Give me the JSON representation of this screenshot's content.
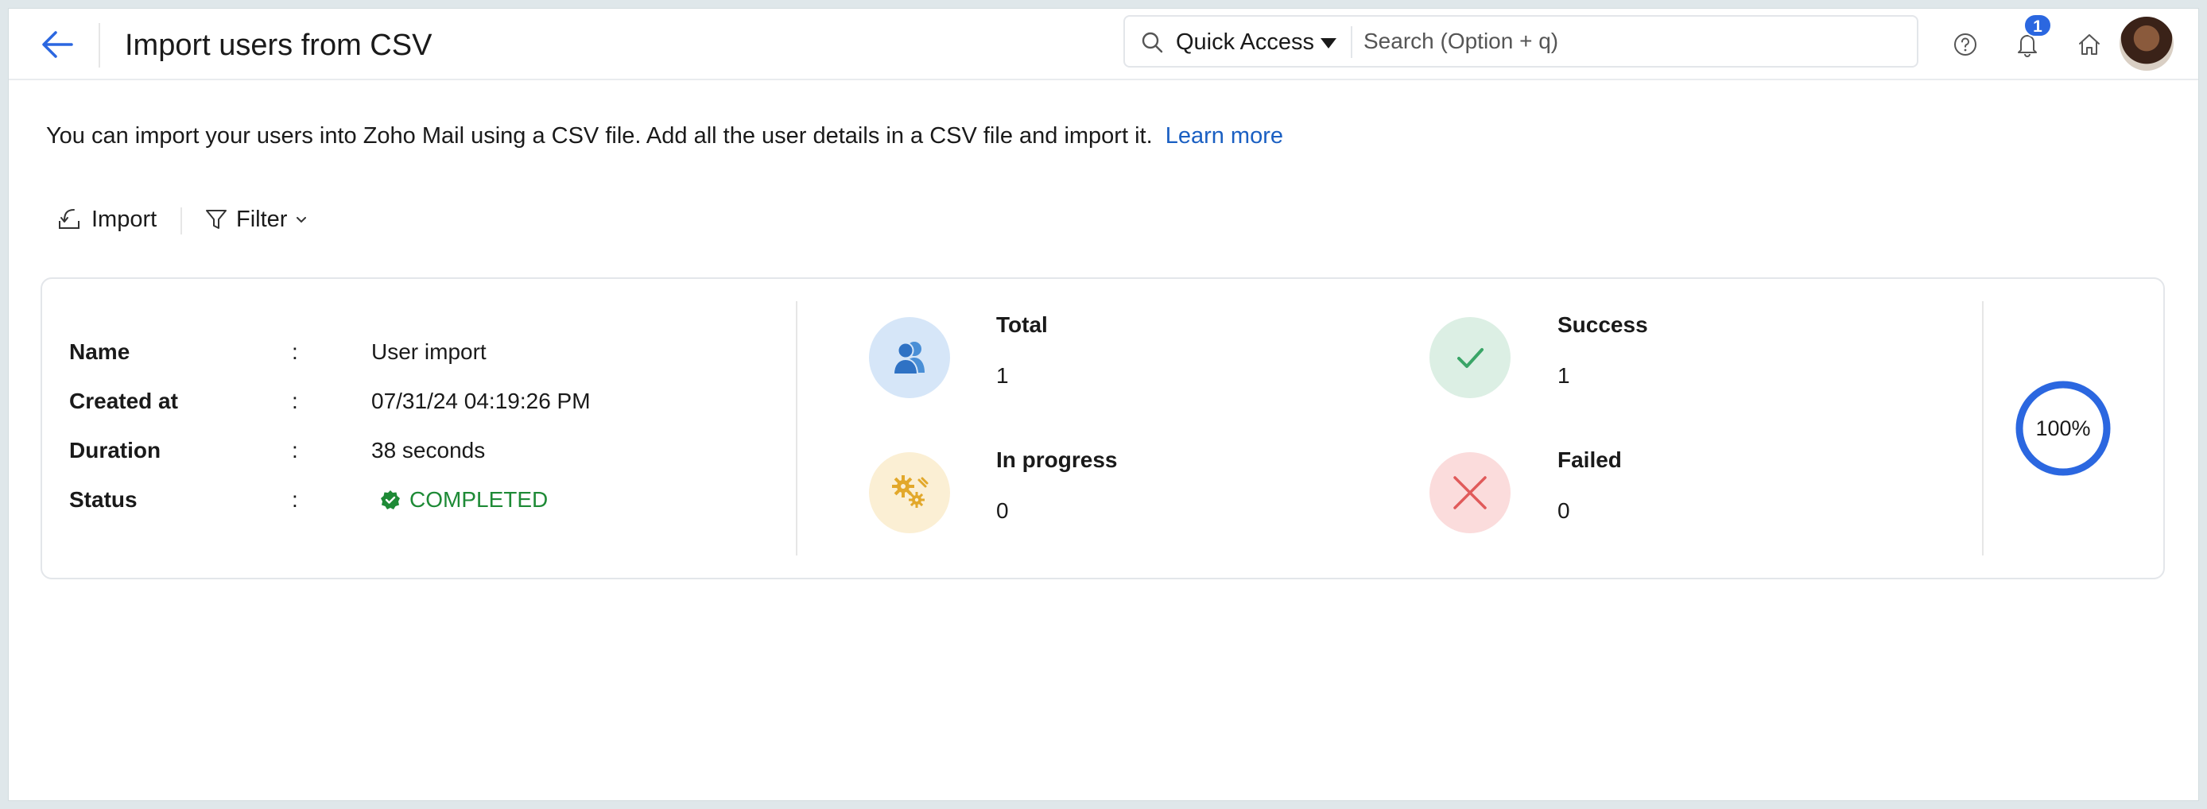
{
  "header": {
    "title": "Import users from CSV",
    "quick_access_label": "Quick Access",
    "search_placeholder": "Search (Option + q)",
    "notification_count": "1"
  },
  "intro": {
    "text": "You can import your users into Zoho Mail using a CSV file. Add all the user details in a CSV file and import it.",
    "link": "Learn more"
  },
  "toolbar": {
    "import_label": "Import",
    "filter_label": "Filter"
  },
  "import_job": {
    "rows": [
      {
        "key": "Name",
        "value": "User import"
      },
      {
        "key": "Created at",
        "value": "07/31/24 04:19:26 PM"
      },
      {
        "key": "Duration",
        "value": "38 seconds"
      },
      {
        "key": "Status",
        "value": "COMPLETED"
      }
    ],
    "colon": ":"
  },
  "stats": {
    "total": {
      "label": "Total",
      "value": "1"
    },
    "success": {
      "label": "Success",
      "value": "1"
    },
    "in_progress": {
      "label": "In progress",
      "value": "0"
    },
    "failed": {
      "label": "Failed",
      "value": "0"
    }
  },
  "progress": {
    "label": "100%",
    "fraction": 1.0
  },
  "colors": {
    "accent": "#2b67e0",
    "link": "#1a5fc2",
    "status_completed": "#1e8a36",
    "total_bg": "#d6e6f8",
    "success_bg": "#dcefe4",
    "in_progress_bg": "#fbefd4",
    "failed_bg": "#fbdcdc"
  },
  "icons": {
    "back": "arrow-left-icon",
    "search": "search-icon",
    "help": "help-circle-icon",
    "notifications": "bell-icon",
    "home": "home-icon",
    "import": "import-icon",
    "filter": "filter-icon",
    "total": "users-icon",
    "success": "check-icon",
    "in_progress": "gears-icon",
    "failed": "x-icon",
    "status": "verified-badge-icon"
  }
}
